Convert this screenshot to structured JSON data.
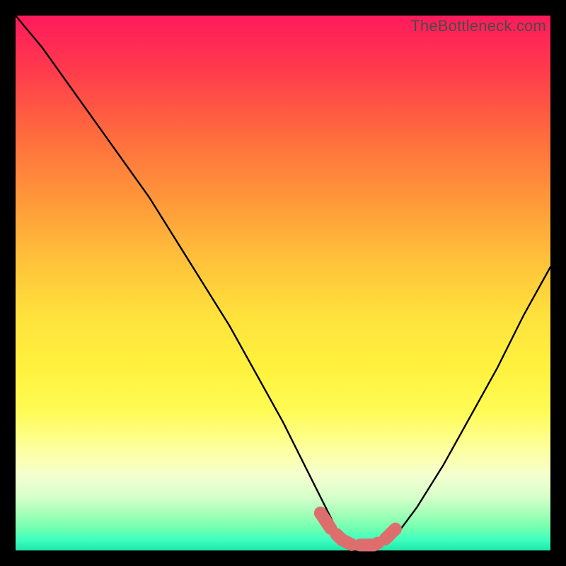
{
  "watermark": "TheBottleneck.com",
  "colors": {
    "page_bg": "#000000",
    "curve_stroke": "#000000",
    "marker_stroke": "#de6e6e",
    "marker_fill": "#de6e6e"
  },
  "chart_data": {
    "type": "line",
    "title": "",
    "xlabel": "",
    "ylabel": "",
    "xlim": [
      0,
      100
    ],
    "ylim": [
      0,
      100
    ],
    "series": [
      {
        "name": "bottleneck-curve",
        "x": [
          0,
          5,
          10,
          15,
          20,
          25,
          30,
          35,
          40,
          45,
          50,
          55,
          58,
          60,
          62,
          64,
          66,
          68,
          70,
          72,
          75,
          80,
          85,
          90,
          95,
          100
        ],
        "values": [
          100,
          94,
          87,
          80,
          73,
          66,
          58,
          50,
          42,
          33,
          24,
          14,
          8,
          4,
          2,
          1,
          1,
          1,
          2,
          4,
          8,
          16,
          25,
          34,
          44,
          53
        ]
      }
    ],
    "markers": {
      "name": "highlight-segment",
      "x": [
        57,
        59,
        61,
        63,
        65,
        67,
        69,
        71
      ],
      "values": [
        7,
        4,
        2,
        1,
        1,
        1,
        2,
        4
      ]
    }
  }
}
